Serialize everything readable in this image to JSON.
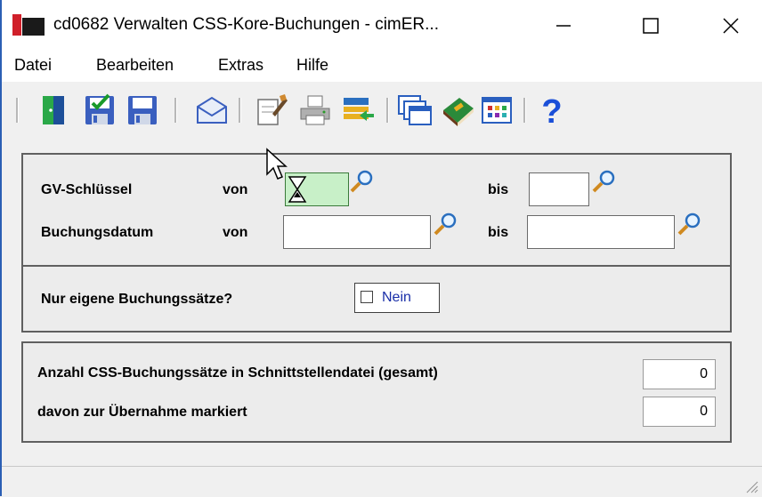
{
  "window": {
    "title": "cd0682 Verwalten CSS-Kore-Buchungen - cimER...",
    "minimize_symbol": "—",
    "maximize_symbol": "☐",
    "close_symbol": "✕"
  },
  "menu": [
    "Datei",
    "Bearbeiten",
    "Extras",
    "Hilfe"
  ],
  "toolbar": {
    "icons": [
      "exit-door-icon",
      "save-checked-icon",
      "save-icon",
      "mail-icon",
      "edit-icon",
      "print-icon",
      "list-import-icon",
      "windows-icon",
      "book-icon",
      "grid-icon",
      "help-icon"
    ]
  },
  "filter": {
    "gv_label": "GV-Schlüssel",
    "von_label": "von",
    "bis_label": "bis",
    "datum_label": "Buchungsdatum",
    "gv_von_value": "",
    "gv_bis_value": "",
    "datum_von_value": "",
    "datum_bis_value": ""
  },
  "own": {
    "question": "Nur eigene Buchungssätze?",
    "checkbox_label": "Nein"
  },
  "stats": {
    "total_label": "Anzahl CSS-Buchungssätze in Schnittstellendatei (gesamt)",
    "total_value": "0",
    "marked_label": "davon zur Übernahme markiert",
    "marked_value": "0"
  },
  "colors": {
    "accent_red": "#d0202a",
    "field_highlight": "#c8f0c8",
    "checkbox_text": "#1a2fa8"
  }
}
